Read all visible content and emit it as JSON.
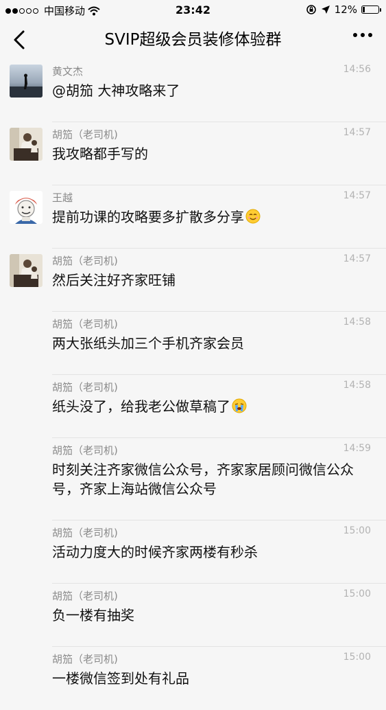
{
  "status_bar": {
    "carrier": "中国移动",
    "time": "23:42",
    "battery_percent": "12%",
    "battery_level": 0.12,
    "signal_bars_filled": 2,
    "signal_bars_total": 5
  },
  "nav": {
    "title": "SVIP超级会员装修体验群",
    "back_icon": "chevron-left-icon",
    "more_icon": "more-dots-icon"
  },
  "messages": [
    {
      "name": "黄文杰",
      "time": "14:56",
      "text": "@胡笳  大神攻略来了",
      "avatar": "photo-avatar-huang"
    },
    {
      "name": "胡笳（老司机)",
      "time": "14:57",
      "text": "我攻略都手写的",
      "avatar": "photo-avatar-hujia"
    },
    {
      "name": "王越",
      "time": "14:57",
      "text": "提前功课的攻略要多扩散多分享",
      "avatar": "cartoon-avatar-wang",
      "emoji": "smile-emoji"
    },
    {
      "name": "胡笳（老司机)",
      "time": "14:57",
      "text": "然后关注好齐家旺铺",
      "avatar": "photo-avatar-hujia"
    },
    {
      "name": "胡笳（老司机)",
      "time": "14:58",
      "text": "两大张纸头加三个手机齐家会员"
    },
    {
      "name": "胡笳（老司机)",
      "time": "14:58",
      "text": "纸头没了，给我老公做草稿了",
      "emoji": "crying-emoji"
    },
    {
      "name": "胡笳（老司机)",
      "time": "14:59",
      "text": "时刻关注齐家微信公众号，齐家家居顾问微信公众号，齐家上海站微信公众号"
    },
    {
      "name": "胡笳（老司机)",
      "time": "15:00",
      "text": "活动力度大的时候齐家两楼有秒杀"
    },
    {
      "name": "胡笳（老司机)",
      "time": "15:00",
      "text": "负一楼有抽奖"
    },
    {
      "name": "胡笳（老司机)",
      "time": "15:00",
      "text": "一楼微信签到处有礼品"
    }
  ],
  "colors": {
    "background": "#f6f6f6",
    "name": "#8a8a8a",
    "time": "#b3b3b3",
    "text": "#111111",
    "divider": "#e3e3e3"
  }
}
